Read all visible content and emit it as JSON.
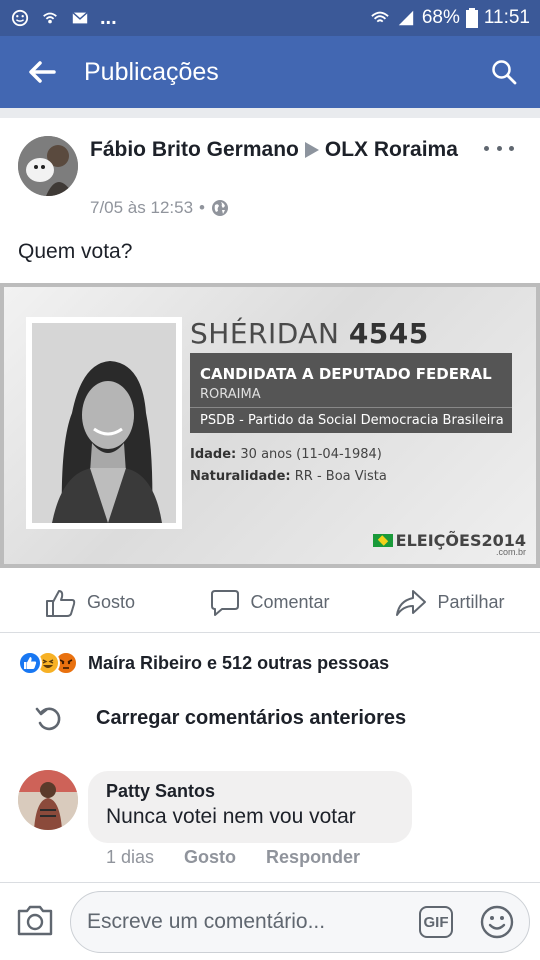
{
  "status_bar": {
    "battery": "68%",
    "time": "11:51",
    "ellipsis": "..."
  },
  "app_bar": {
    "title": "Publicações"
  },
  "post": {
    "author": "Fábio Brito Germano",
    "target_group": "OLX Roraima",
    "timestamp": "7/05 às 12:53",
    "separator": "•",
    "text": "Quem vota?",
    "image_card": {
      "candidate_name": "SHÉRIDAN",
      "candidate_number": "4545",
      "office": "CANDIDATA A DEPUTADO FEDERAL",
      "state": "RORAIMA",
      "party": "PSDB - Partido da Social Democracia Brasileira",
      "age_label": "Idade:",
      "age_value": "30 anos (11-04-1984)",
      "birthplace_label": "Naturalidade:",
      "birthplace_value": "RR - Boa Vista",
      "logo_text": "ELEIÇÕES2014",
      "logo_domain": ".com.br"
    },
    "actions": {
      "like": "Gosto",
      "comment": "Comentar",
      "share": "Partilhar"
    },
    "reactions_summary": "Maíra Ribeiro e 512 outras pessoas",
    "load_previous": "Carregar comentários anteriores"
  },
  "comment": {
    "author": "Patty Santos",
    "text": "Nunca votei nem vou votar",
    "age": "1 dias",
    "like": "Gosto",
    "reply": "Responder"
  },
  "composer": {
    "placeholder": "Escreve um comentário...",
    "gif_label": "GIF"
  },
  "colors": {
    "status_bar": "#3b5998",
    "app_bar": "#4267b2",
    "like_blue": "#1877f2",
    "haha_yellow": "#f7b125",
    "angry_red": "#e9710f"
  }
}
